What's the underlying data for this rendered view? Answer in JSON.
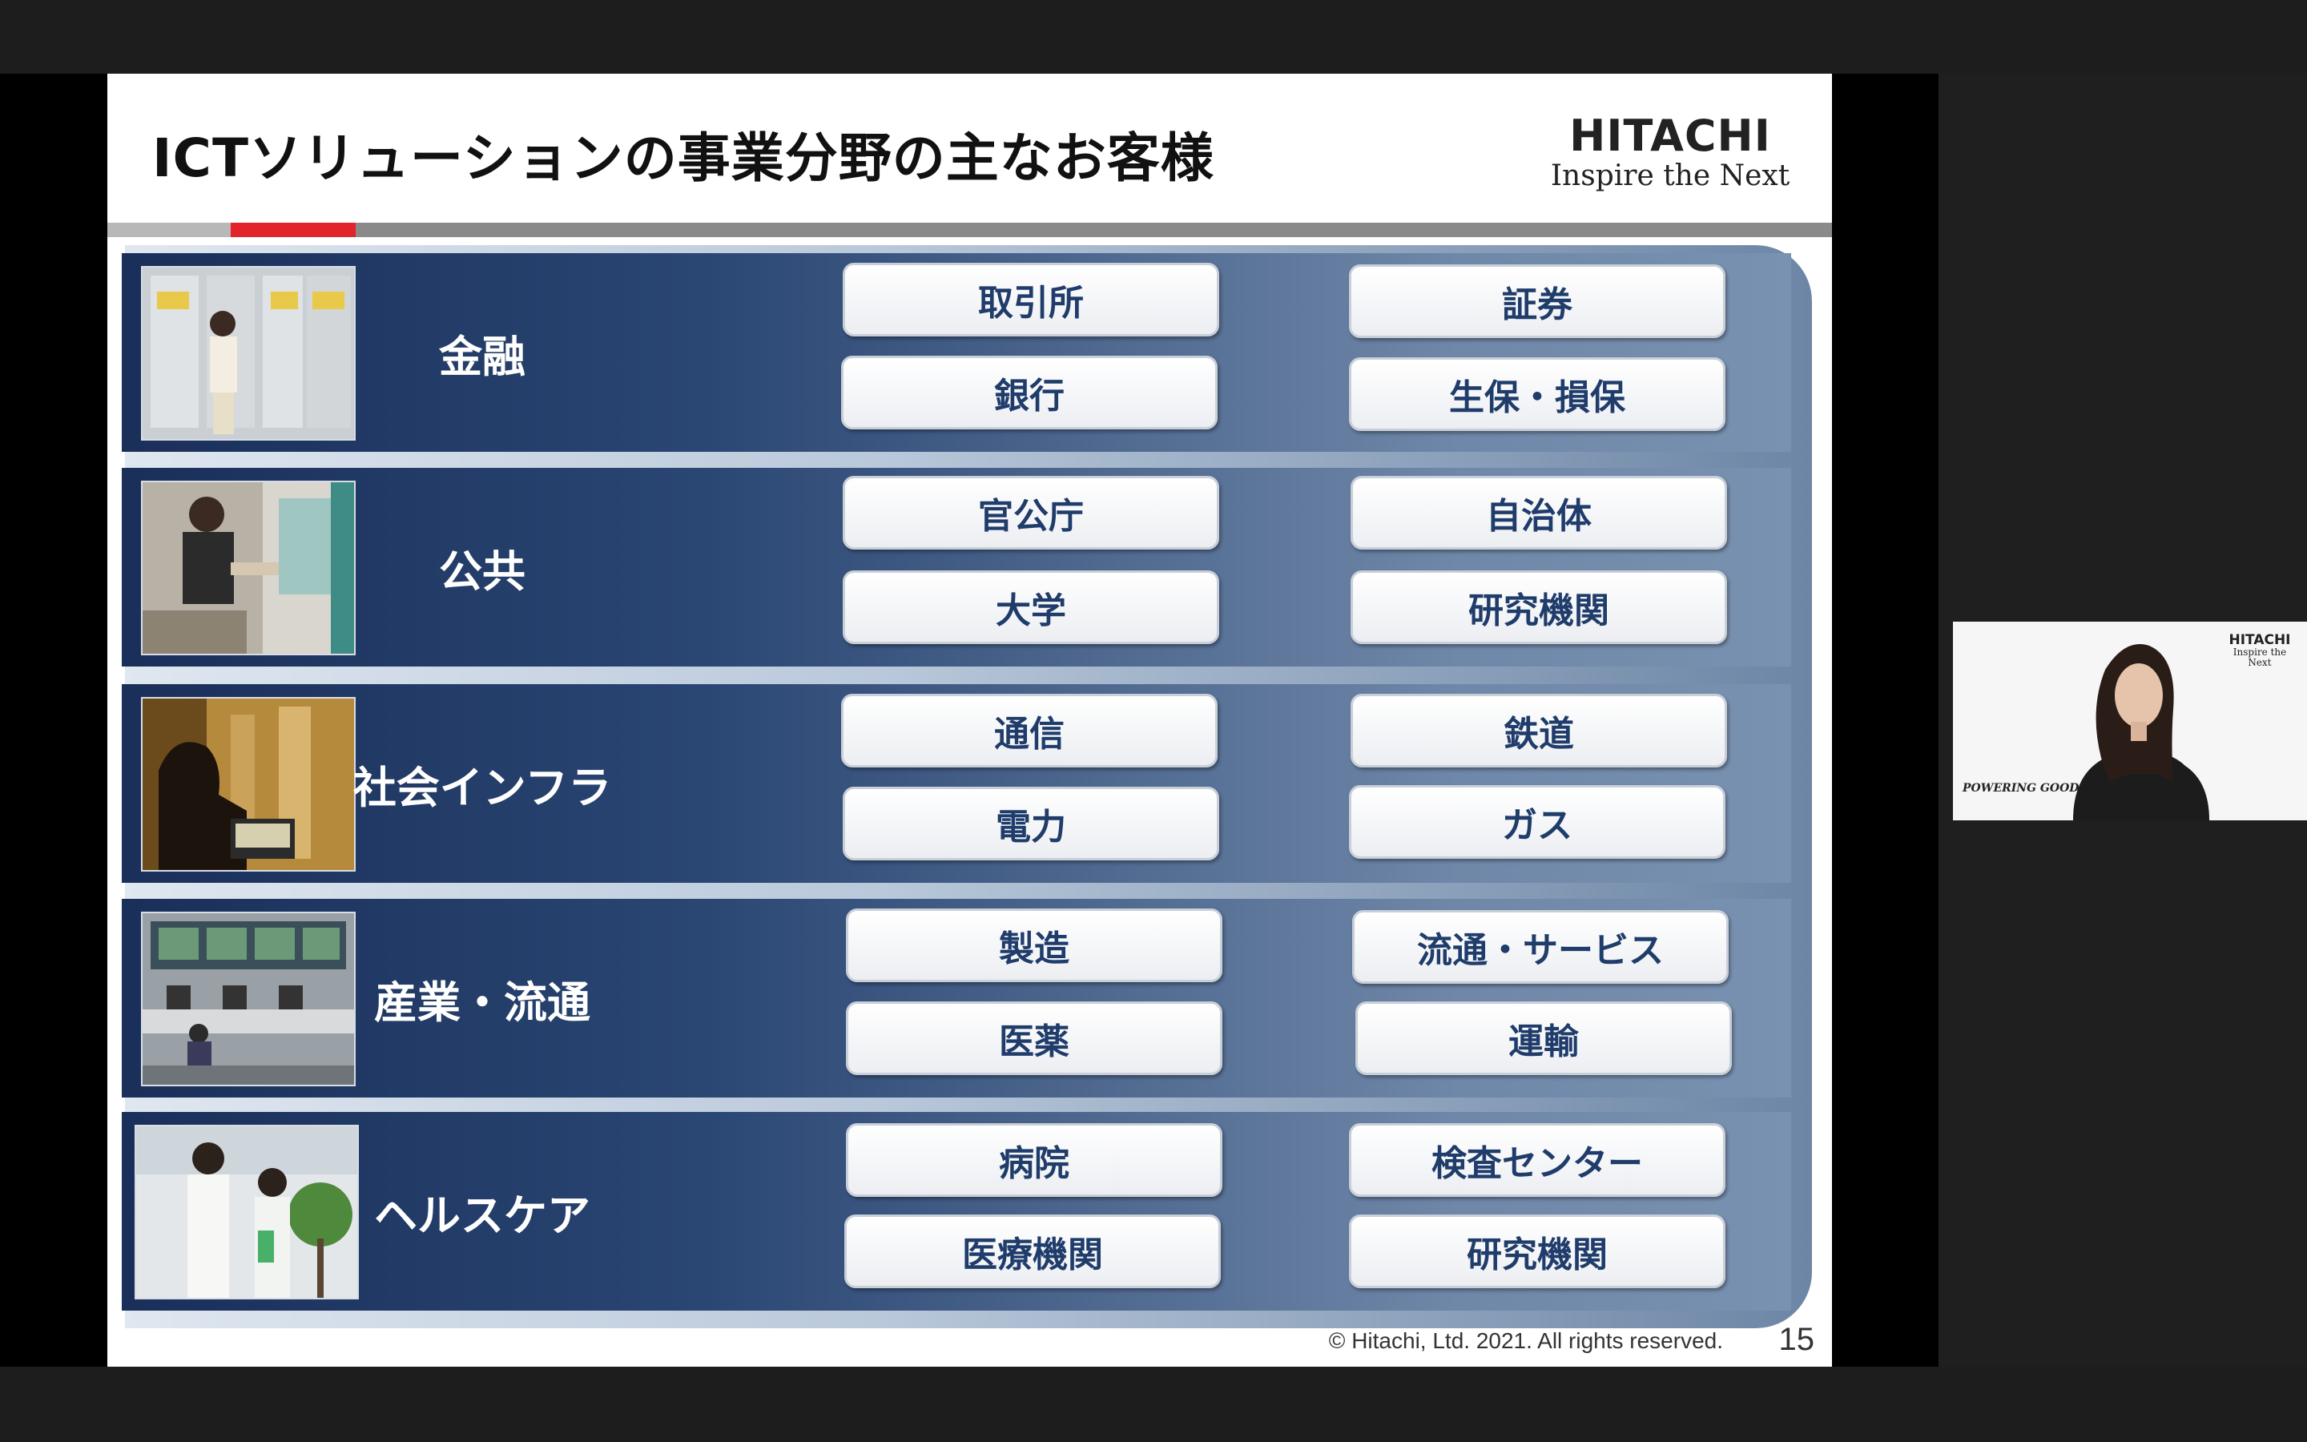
{
  "slide": {
    "title": "ICTソリューションの事業分野の主なお客様",
    "logo": {
      "word": "HITACHI",
      "tagline": "Inspire the Next"
    },
    "footer": {
      "copyright": "© Hitachi, Ltd. 2021. All rights reserved.",
      "page_number": "15"
    },
    "colors": {
      "accent": "#e2232a",
      "panel_dark": "#1a2f5a",
      "pill_text": "#1f3c6b"
    }
  },
  "sectors": [
    {
      "label": "金融",
      "photo": "atm-woman-photo",
      "customers": [
        "取引所",
        "証券",
        "銀行",
        "生保・損保"
      ]
    },
    {
      "label": "公共",
      "photo": "kiosk-woman-photo",
      "customers": [
        "官公庁",
        "自治体",
        "大学",
        "研究機関"
      ]
    },
    {
      "label": "社会インフラ",
      "photo": "factory-silhouette-photo",
      "customers": [
        "通信",
        "鉄道",
        "電力",
        "ガス"
      ]
    },
    {
      "label": "産業・流通",
      "photo": "control-room-photo",
      "customers": [
        "製造",
        "流通・サービス",
        "医薬",
        "運輸"
      ]
    },
    {
      "label": "ヘルスケア",
      "photo": "doctor-nurse-photo",
      "customers": [
        "病院",
        "検査センター",
        "医療機関",
        "研究機関"
      ]
    }
  ],
  "webcam": {
    "logo_word": "HITACHI",
    "logo_tagline": "Inspire the Next",
    "tagline": "POWERING GOOD"
  }
}
